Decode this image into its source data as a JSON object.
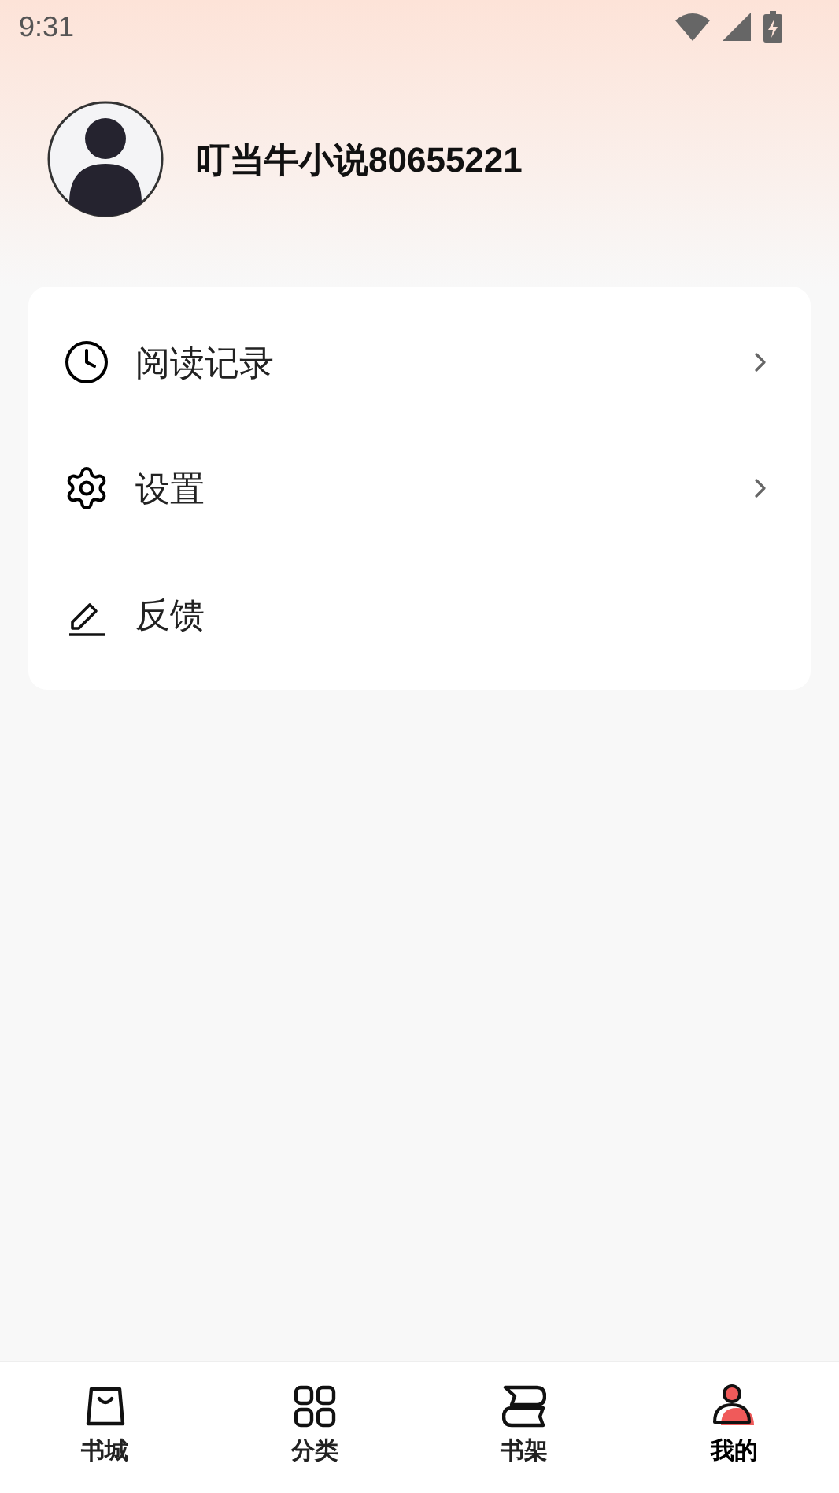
{
  "status_bar": {
    "time": "9:31"
  },
  "profile": {
    "username": "叮当牛小说80655221"
  },
  "menu": [
    {
      "kind": "history",
      "label": "阅读记录",
      "chevron": true
    },
    {
      "kind": "settings",
      "label": "设置",
      "chevron": true
    },
    {
      "kind": "feedback",
      "label": "反馈",
      "chevron": false
    }
  ],
  "tabs": [
    {
      "kind": "store",
      "label": "书城",
      "selected": false
    },
    {
      "kind": "category",
      "label": "分类",
      "selected": false
    },
    {
      "kind": "shelf",
      "label": "书架",
      "selected": false
    },
    {
      "kind": "me",
      "label": "我的",
      "selected": true
    }
  ]
}
